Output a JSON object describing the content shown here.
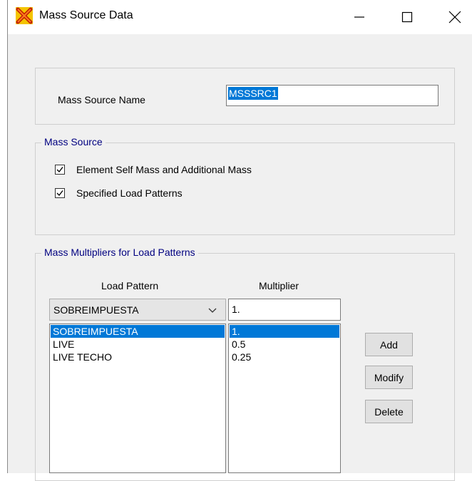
{
  "window": {
    "title": "Mass Source Data"
  },
  "titlebar": {
    "minimize_icon": "minimize-icon",
    "maximize_icon": "maximize-icon",
    "close_icon": "close-icon",
    "app_icon": "app-icon"
  },
  "mass_source_name": {
    "label": "Mass Source Name",
    "value": "MSSSRC1"
  },
  "mass_source": {
    "legend": "Mass Source",
    "options": [
      {
        "label": "Element Self Mass and Additional Mass",
        "checked": true
      },
      {
        "label": "Specified Load Patterns",
        "checked": true
      }
    ]
  },
  "multipliers": {
    "legend": "Mass Multipliers for Load Patterns",
    "col_load_pattern": "Load Pattern",
    "col_multiplier": "Multiplier",
    "combo_value": "SOBREIMPUESTA",
    "multiplier_value": "1.",
    "load_patterns": [
      "SOBREIMPUESTA",
      "LIVE",
      "LIVE TECHO"
    ],
    "multiplier_list": [
      "1.",
      "0.5",
      "0.25"
    ],
    "selected_index": 0
  },
  "buttons": {
    "add": "Add",
    "modify": "Modify",
    "delete": "Delete"
  },
  "colors": {
    "selection": "#0078d7",
    "legend_text": "#000080",
    "window_bg": "#f0f0f0"
  }
}
